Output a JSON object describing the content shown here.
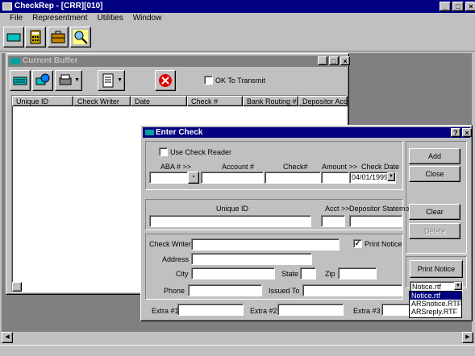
{
  "app": {
    "title": "CheckRep - [CRR][010]",
    "menu": [
      "File",
      "Representment",
      "Utilities",
      "Window"
    ]
  },
  "current_buffer": {
    "title": "Current Buffer",
    "ok_to_transmit_label": "OK To Transmit",
    "columns": [
      "Unique ID",
      "Check Writer",
      "Date",
      "Check #",
      "Bank Routing #",
      "Depositor Acc..."
    ]
  },
  "enter_check": {
    "title": "Enter Check",
    "use_check_reader_label": "Use Check Reader",
    "routing_label": "ABA # >>",
    "account_label": "Account #",
    "check_no_label": "Check#",
    "amount_label": "Amount >>",
    "check_date_label": "Check Date",
    "check_date_value": "04/01/1999",
    "unique_id_label": "Unique ID",
    "acct_label": "Acct >>",
    "depositor_statement_label": "Depositor Statement",
    "check_writer_label": "Check Writer",
    "print_notice_label": "Print Notice",
    "address_label": "Address",
    "city_label": "City",
    "state_label": "State",
    "zip_label": "Zip",
    "phone_label": "Phone",
    "issued_to_label": "Issued To",
    "extra1_label": "Extra #1",
    "extra2_label": "Extra #2",
    "extra3_label": "Extra #3",
    "buttons": {
      "add": "Add",
      "close": "Close",
      "clear": "Clear",
      "delete": "Delete",
      "print_notice": "Print Notice"
    },
    "notice_select_value": "Notice.rtf",
    "notice_options": [
      "Notice.rtf",
      "ARSnotice.RTF",
      "ARSreply.RTF"
    ]
  },
  "colors": {
    "active_title": "#000080",
    "inactive_title": "#808080",
    "face": "#c0c0c0",
    "workspace": "#808080"
  }
}
